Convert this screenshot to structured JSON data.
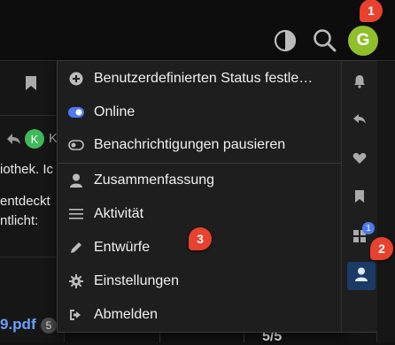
{
  "header": {
    "avatar_initial": "G",
    "notification_badge": "1"
  },
  "background": {
    "left_text_1": "iothek. Ic",
    "left_text_2": "entdeckt",
    "left_text_3": "ntlicht:",
    "reply_user_initial": "K",
    "reply_user_suffix": "K",
    "pdf_link": "9.pdf",
    "pdf_count": "5",
    "page_counter": "5/5"
  },
  "menu": {
    "items": [
      {
        "label": "Benutzerdefinierten Status festle…",
        "icon": "plus-circle-icon"
      },
      {
        "label": "Online",
        "icon": "toggle-on-icon"
      },
      {
        "label": "Benachrichtigungen pausieren",
        "icon": "toggle-off-icon"
      },
      {
        "label": "Zusammenfassung",
        "icon": "user-icon"
      },
      {
        "label": "Aktivität",
        "icon": "list-icon"
      },
      {
        "label": "Entwürfe",
        "icon": "pencil-icon"
      },
      {
        "label": "Einstellungen",
        "icon": "gear-icon"
      },
      {
        "label": "Abmelden",
        "icon": "sign-out-icon"
      }
    ],
    "step_badge_settings": "3"
  },
  "side": {
    "chat_badge": "1",
    "profile_step_badge": "2",
    "icons": [
      "bell-icon",
      "reply-icon",
      "heart-icon",
      "bookmark-icon",
      "grid-icon",
      "user-icon"
    ]
  },
  "colors": {
    "accent_green": "#8fbf2b",
    "badge_red": "#e8412d",
    "online_blue": "#4e79f0",
    "active_tab_bg": "#1b3a66"
  }
}
